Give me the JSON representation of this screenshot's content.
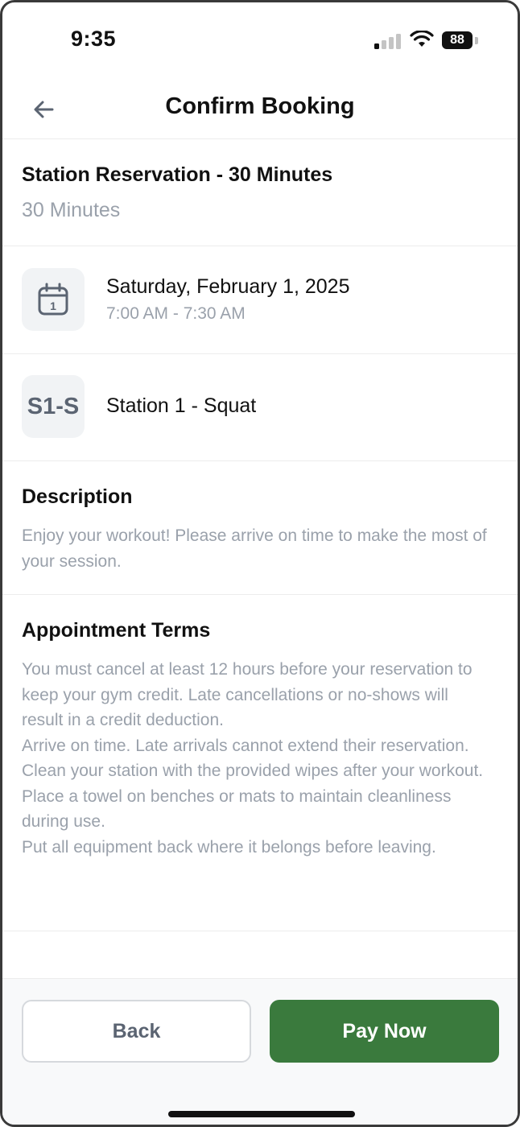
{
  "status_bar": {
    "time": "9:35",
    "battery": "88",
    "icons": [
      "signal-icon",
      "wifi-icon",
      "battery-icon"
    ]
  },
  "header": {
    "title": "Confirm Booking",
    "back_icon": "arrow-left-icon"
  },
  "service": {
    "title": "Station Reservation - 30 Minutes",
    "duration": "30 Minutes"
  },
  "schedule": {
    "icon": "calendar-icon",
    "date": "Saturday, February 1, 2025",
    "time": "7:00 AM - 7:30 AM"
  },
  "station": {
    "abbreviation": "S1-S",
    "name": "Station 1 - Squat"
  },
  "description": {
    "heading": "Description",
    "text": "Enjoy your workout! Please arrive on time to make the most of your session."
  },
  "terms": {
    "heading": "Appointment Terms",
    "lines": [
      "You must cancel at least 12 hours before your reservation to keep your gym credit. Late cancellations or no-shows will result in a credit deduction.",
      "Arrive on time. Late arrivals cannot extend their reservation.",
      "Clean your station with the provided wipes after your workout.",
      "Place a towel on benches or mats to maintain cleanliness during use.",
      "Put all equipment back where it belongs before leaving."
    ]
  },
  "footer": {
    "back_label": "Back",
    "pay_label": "Pay Now"
  },
  "colors": {
    "accent": "#3a7a3d",
    "muted_text": "#9aa1ab",
    "tile_bg": "#f1f3f5"
  }
}
